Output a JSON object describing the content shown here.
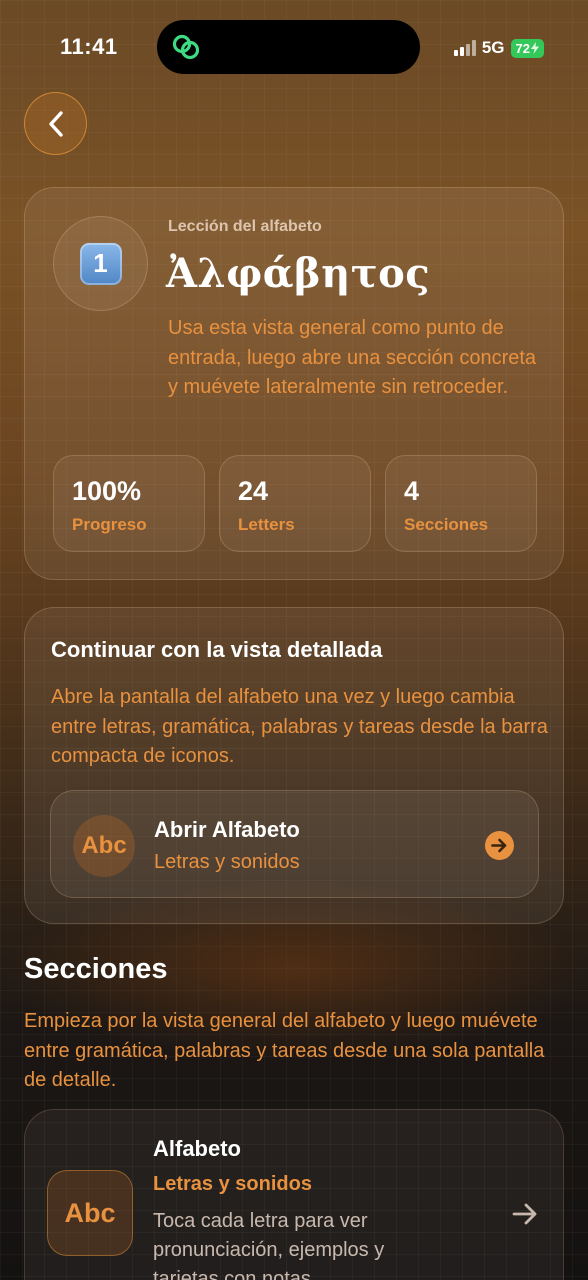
{
  "status": {
    "time": "11:41",
    "network": "5G",
    "battery": "72"
  },
  "colors": {
    "accent": "#e8913f",
    "battery": "#34c759",
    "island_icon": "#3ddc84"
  },
  "icons": {
    "back": "chevron-left-icon",
    "island": "link-rings-icon",
    "lesson": "keycap-one-icon",
    "open_arrow": "arrow-right-circle-icon",
    "section_arrow": "arrow-right-icon"
  },
  "hero": {
    "badge_digit": "1",
    "eyebrow": "Lección del alfabeto",
    "title": "Ἀλφάβητος",
    "description": "Usa esta vista general como punto de entrada, luego abre una sección concreta y muévete lateralmente sin retroceder.",
    "stats": [
      {
        "value": "100%",
        "label": "Progreso"
      },
      {
        "value": "24",
        "label": "Letters"
      },
      {
        "value": "4",
        "label": "Secciones"
      }
    ]
  },
  "continue": {
    "title": "Continuar con la vista detallada",
    "description": "Abre la pantalla del alfabeto una vez y luego cambia entre letras, gramática, palabras y tareas desde la barra compacta de iconos.",
    "action": {
      "icon_text": "Abc",
      "title": "Abrir Alfabeto",
      "subtitle": "Letras y sonidos"
    }
  },
  "sections": {
    "heading": "Secciones",
    "description": "Empieza por la vista general del alfabeto y luego muévete entre gramática, palabras y tareas desde una sola pantalla de detalle.",
    "items": [
      {
        "icon_text": "Abc",
        "title": "Alfabeto",
        "subtitle": "Letras y sonidos",
        "text": "Toca cada letra para ver pronunciación, ejemplos y tarjetas con notas."
      }
    ]
  }
}
